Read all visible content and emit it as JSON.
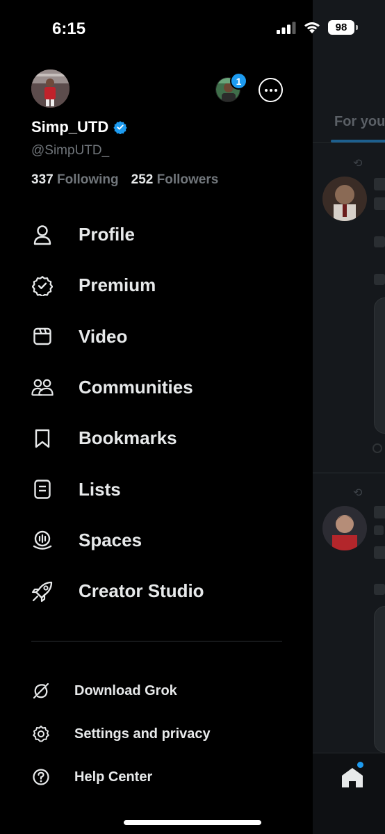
{
  "status_bar": {
    "time": "6:15",
    "battery": "98",
    "icons": [
      "cellular-signal-icon",
      "wifi-icon",
      "battery-icon"
    ]
  },
  "account": {
    "display_name": "Simp_UTD",
    "handle": "@SimpUTD_",
    "verified": true,
    "following_count": "337",
    "following_label": "Following",
    "followers_count": "252",
    "followers_label": "Followers",
    "switch_badge": "1"
  },
  "menu": {
    "items": [
      {
        "label": "Profile",
        "icon": "person-icon"
      },
      {
        "label": "Premium",
        "icon": "verified-badge-icon"
      },
      {
        "label": "Video",
        "icon": "video-icon"
      },
      {
        "label": "Communities",
        "icon": "communities-icon"
      },
      {
        "label": "Bookmarks",
        "icon": "bookmark-icon"
      },
      {
        "label": "Lists",
        "icon": "list-icon"
      },
      {
        "label": "Spaces",
        "icon": "spaces-icon"
      },
      {
        "label": "Creator Studio",
        "icon": "rocket-icon"
      }
    ]
  },
  "secondary_menu": {
    "items": [
      {
        "label": "Download Grok",
        "icon": "grok-icon"
      },
      {
        "label": "Settings and privacy",
        "icon": "gear-icon"
      },
      {
        "label": "Help Center",
        "icon": "help-icon"
      }
    ]
  },
  "background_feed": {
    "tab_label": "For you"
  },
  "colors": {
    "accent": "#1d9bf0",
    "background": "#000000",
    "text_primary": "#e7e9ea",
    "text_secondary": "#71767b"
  }
}
